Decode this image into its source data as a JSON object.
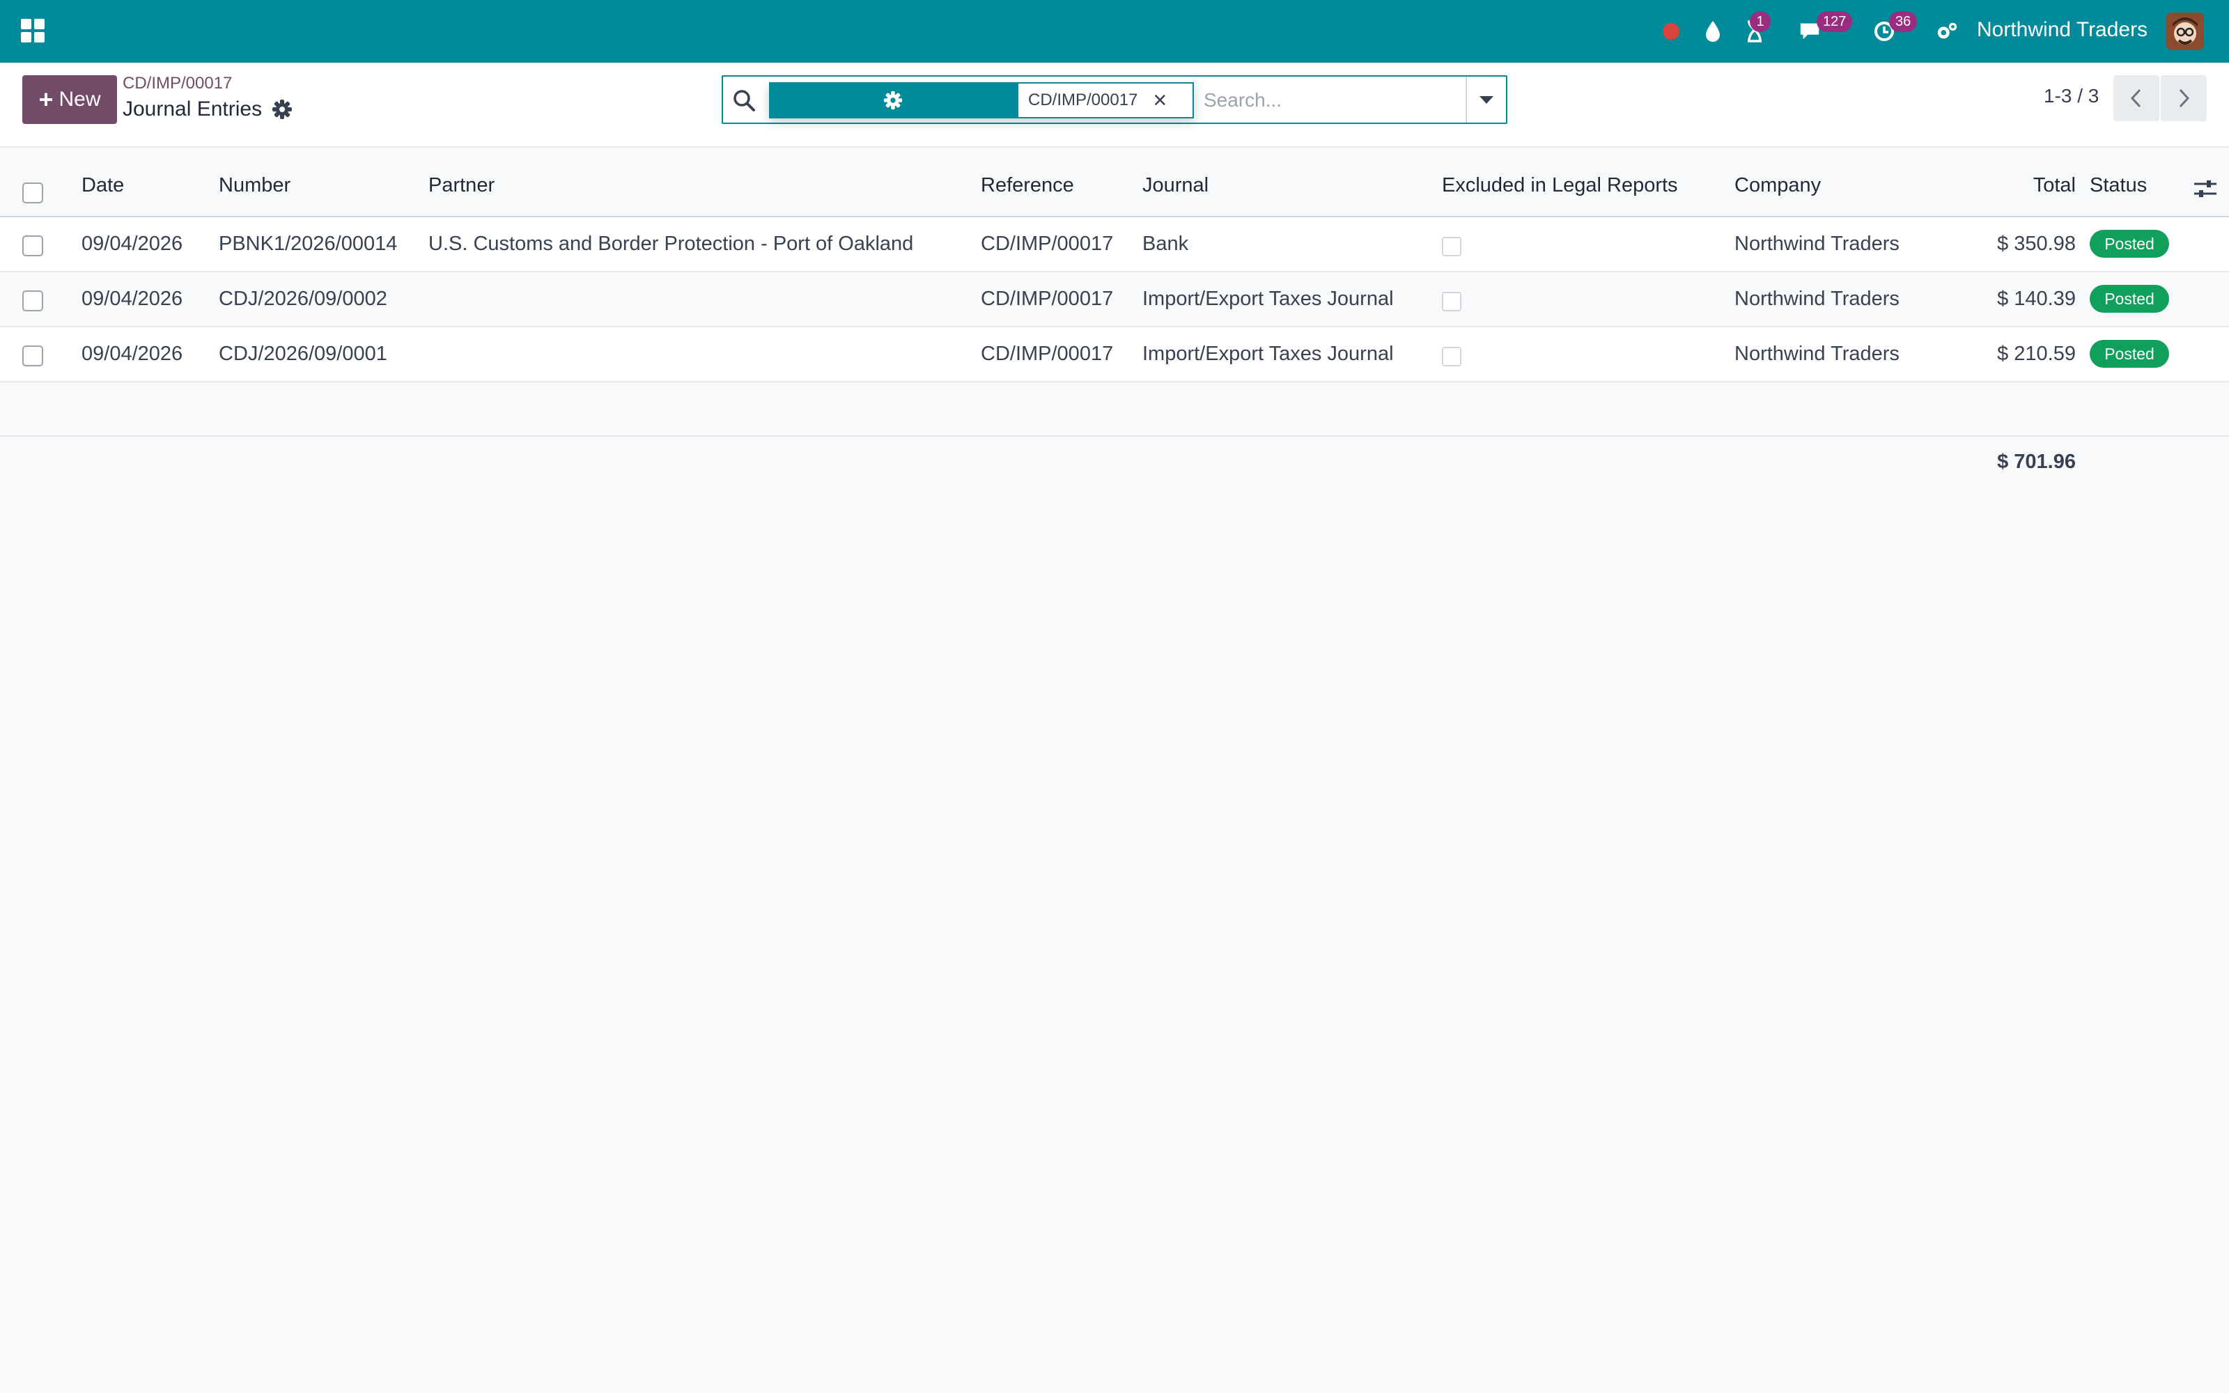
{
  "navbar": {
    "company": "Northwind Traders",
    "activity_badge": "1",
    "messages_badge": "127",
    "clock_badge": "36",
    "icons": [
      "apps-grid-icon",
      "record-dot-icon",
      "droplet-icon",
      "hourglass-icon",
      "chat-icon",
      "clock-icon",
      "settings-cogs-icon"
    ],
    "colors": {
      "bar": "#018a9a",
      "badge": "#9b2d80",
      "record": "#d9453d"
    }
  },
  "control_panel": {
    "new_label": "New",
    "breadcrumb": "CD/IMP/00017",
    "title": "Journal Entries",
    "search": {
      "facet_value": "CD/IMP/00017",
      "placeholder": "Search..."
    },
    "pager": "1-3 / 3"
  },
  "table": {
    "columns": {
      "date": "Date",
      "number": "Number",
      "partner": "Partner",
      "reference": "Reference",
      "journal": "Journal",
      "excluded": "Excluded in Legal Reports",
      "company": "Company",
      "total": "Total",
      "status": "Status"
    },
    "rows": [
      {
        "date": "09/04/2026",
        "number": "PBNK1/2026/00014",
        "partner": "U.S. Customs and Border Protection - Port of Oakland",
        "reference": "CD/IMP/00017",
        "journal": "Bank",
        "excluded": false,
        "company": "Northwind Traders",
        "total": "$ 350.98",
        "status": "Posted"
      },
      {
        "date": "09/04/2026",
        "number": "CDJ/2026/09/0002",
        "partner": "",
        "reference": "CD/IMP/00017",
        "journal": "Import/Export Taxes Journal",
        "excluded": false,
        "company": "Northwind Traders",
        "total": "$ 140.39",
        "status": "Posted"
      },
      {
        "date": "09/04/2026",
        "number": "CDJ/2026/09/0001",
        "partner": "",
        "reference": "CD/IMP/00017",
        "journal": "Import/Export Taxes Journal",
        "excluded": false,
        "company": "Northwind Traders",
        "total": "$ 210.59",
        "status": "Posted"
      }
    ],
    "sum_total": "$ 701.96",
    "status_color": "#10a05c"
  }
}
